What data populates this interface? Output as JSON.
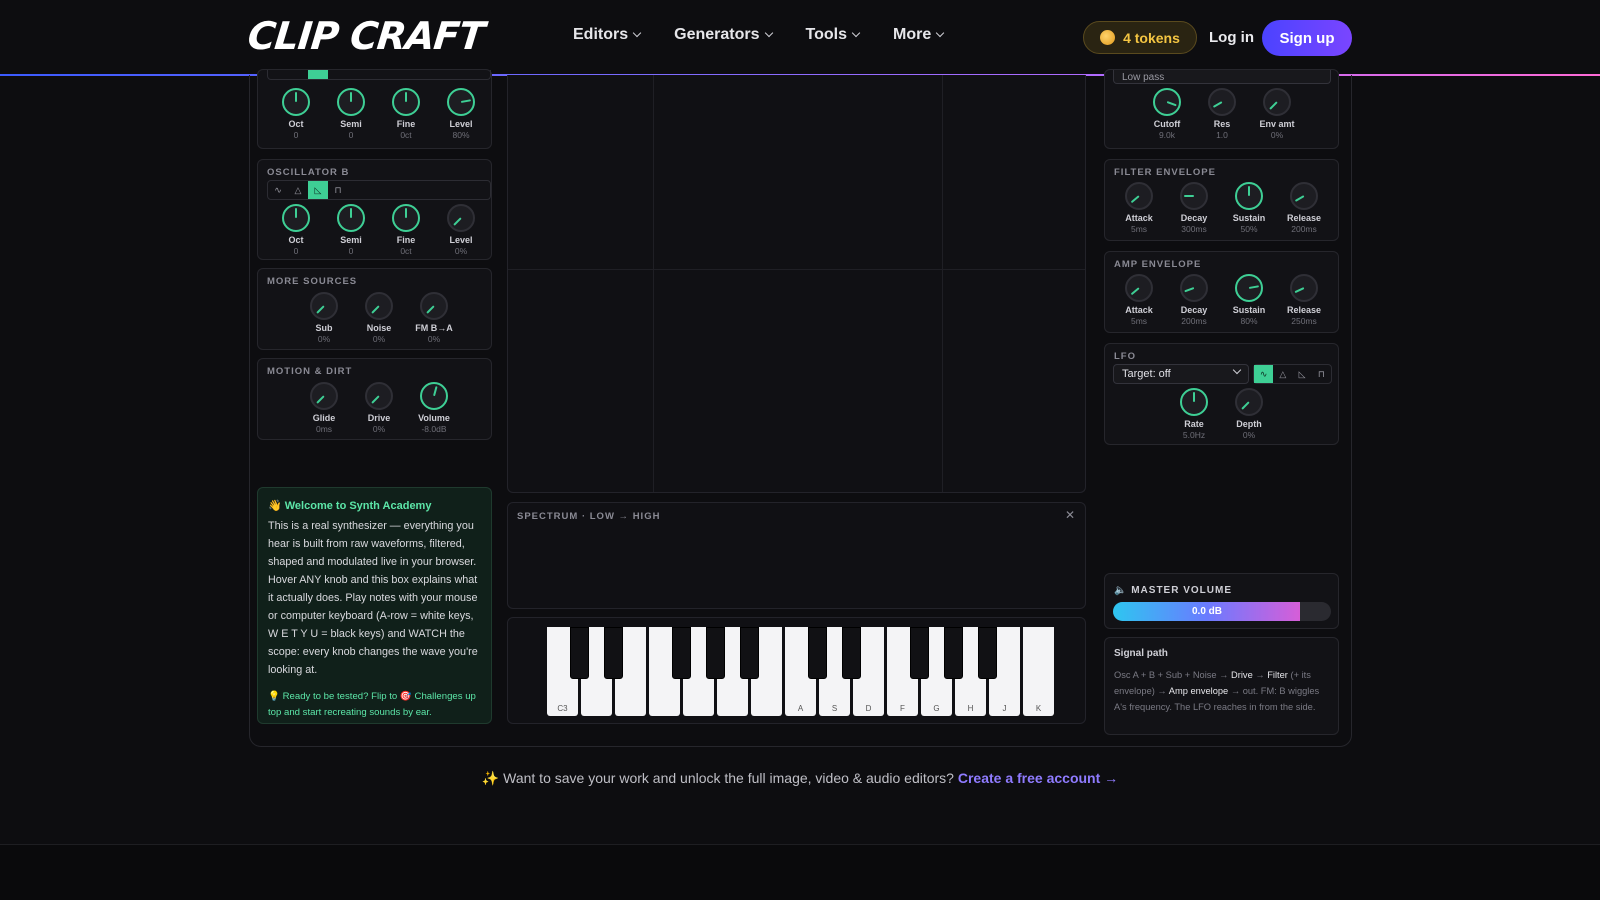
{
  "nav": {
    "logo": "CLIP CRAFT",
    "menu": [
      {
        "label": "Editors"
      },
      {
        "label": "Generators"
      },
      {
        "label": "Tools"
      },
      {
        "label": "More"
      }
    ],
    "tokens": "4 tokens",
    "login": "Log in",
    "signup": "Sign up"
  },
  "osc_a": {
    "knobs": [
      {
        "label": "Oct",
        "value": "0"
      },
      {
        "label": "Semi",
        "value": "0"
      },
      {
        "label": "Fine",
        "value": "0ct"
      },
      {
        "label": "Level",
        "value": "80%"
      }
    ]
  },
  "osc_b": {
    "title": "OSCILLATOR B",
    "waves": [
      "∿",
      "△",
      "◺",
      "⊓"
    ],
    "knobs": [
      {
        "label": "Oct",
        "value": "0"
      },
      {
        "label": "Semi",
        "value": "0"
      },
      {
        "label": "Fine",
        "value": "0ct"
      },
      {
        "label": "Level",
        "value": "0%"
      }
    ]
  },
  "more_sources": {
    "title": "MORE SOURCES",
    "knobs": [
      {
        "label": "Sub",
        "value": "0%"
      },
      {
        "label": "Noise",
        "value": "0%"
      },
      {
        "label": "FM B→A",
        "value": "0%"
      }
    ]
  },
  "motion": {
    "title": "MOTION & DIRT",
    "knobs": [
      {
        "label": "Glide",
        "value": "0ms"
      },
      {
        "label": "Drive",
        "value": "0%"
      },
      {
        "label": "Volume",
        "value": "-8.0dB"
      }
    ]
  },
  "welcome": {
    "title": "👋 Welcome to Synth Academy",
    "body": "This is a real synthesizer — everything you hear is built from raw waveforms, filtered, shaped and modulated live in your browser. Hover ANY knob and this box explains what it actually does. Play notes with your mouse or computer keyboard (A-row = white keys, W E T Y U = black keys) and WATCH the scope: every knob changes the wave you're looking at.",
    "tip": "💡 Ready to be tested? Flip to 🎯 Challenges up top and start recreating sounds by ear."
  },
  "spectrum": {
    "title": "SPECTRUM · LOW → HIGH",
    "close": "✕"
  },
  "keyboard": {
    "white_labels": [
      "C3",
      "",
      "",
      "",
      "",
      "",
      "",
      "A",
      "S",
      "D",
      "F",
      "G",
      "H",
      "J",
      "K"
    ]
  },
  "filter": {
    "type": "Low pass",
    "knobs": [
      {
        "label": "Cutoff",
        "value": "9.0k"
      },
      {
        "label": "Res",
        "value": "1.0"
      },
      {
        "label": "Env amt",
        "value": "0%"
      }
    ]
  },
  "filter_env": {
    "title": "FILTER ENVELOPE",
    "knobs": [
      {
        "label": "Attack",
        "value": "5ms"
      },
      {
        "label": "Decay",
        "value": "300ms"
      },
      {
        "label": "Sustain",
        "value": "50%"
      },
      {
        "label": "Release",
        "value": "200ms"
      }
    ]
  },
  "amp_env": {
    "title": "AMP ENVELOPE",
    "knobs": [
      {
        "label": "Attack",
        "value": "5ms"
      },
      {
        "label": "Decay",
        "value": "200ms"
      },
      {
        "label": "Sustain",
        "value": "80%"
      },
      {
        "label": "Release",
        "value": "250ms"
      }
    ]
  },
  "lfo": {
    "title": "LFO",
    "target": "Target: off",
    "waves": [
      "∿",
      "△",
      "◺",
      "⊓"
    ],
    "knobs": [
      {
        "label": "Rate",
        "value": "5.0Hz"
      },
      {
        "label": "Depth",
        "value": "0%"
      }
    ]
  },
  "master": {
    "title": "🔈 MASTER VOLUME",
    "value": "0.0 dB",
    "level_fraction": 0.86
  },
  "signal_path": {
    "title": "Signal path",
    "pre": "Osc A + B + Sub + Noise → ",
    "drive": "Drive",
    "arrow1": " → ",
    "filter": "Filter",
    "mid": " (+ its envelope) → ",
    "amp": "Amp envelope",
    "post": " → out. FM: B wiggles A's frequency. The LFO reaches in from the side."
  },
  "footer": {
    "text": "✨ Want to save your work and unlock the full image, video & audio editors? ",
    "link": "Create a free account →"
  },
  "colors": {
    "accent": "#3ecf95",
    "brand": "#6a4bff",
    "token": "#f4c542"
  }
}
